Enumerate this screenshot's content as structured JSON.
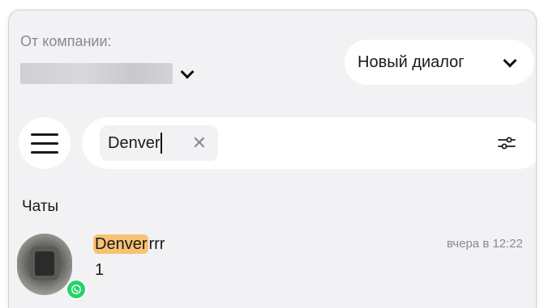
{
  "header": {
    "from_label": "От компании:",
    "new_dialog_label": "Новый диалог"
  },
  "search": {
    "query": "Denver",
    "clear_icon": "close-icon",
    "filter_icon": "sliders-icon",
    "menu_icon": "hamburger-menu-icon"
  },
  "chats": {
    "section_title": "Чаты",
    "items": [
      {
        "name_highlight": "Denver",
        "name_rest": "rrr",
        "preview": "1",
        "time": "вчера в 12:22",
        "channel_icon": "whatsapp-icon"
      }
    ]
  },
  "colors": {
    "highlight": "#f7c272",
    "whatsapp": "#25d366",
    "panel_bg": "#f2f2f4"
  }
}
